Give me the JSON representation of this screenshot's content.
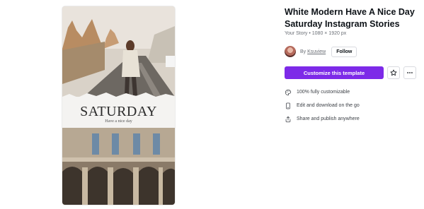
{
  "template": {
    "headline": "SATURDAY",
    "subline": "Have a nice day"
  },
  "details": {
    "title": "White Modern Have A Nice Day Saturday Instagram Stories",
    "meta": "Your Story • 1080 × 1920 px",
    "author_prefix": "By",
    "author_name": "Ksuview",
    "follow_label": "Follow",
    "cta_label": "Customize this template",
    "accent_color": "#7d2ae8",
    "features": [
      {
        "icon": "palette-icon",
        "label": "100% fully customizable"
      },
      {
        "icon": "mobile-icon",
        "label": "Edit and download on the go"
      },
      {
        "icon": "share-icon",
        "label": "Share and publish anywhere"
      }
    ]
  }
}
